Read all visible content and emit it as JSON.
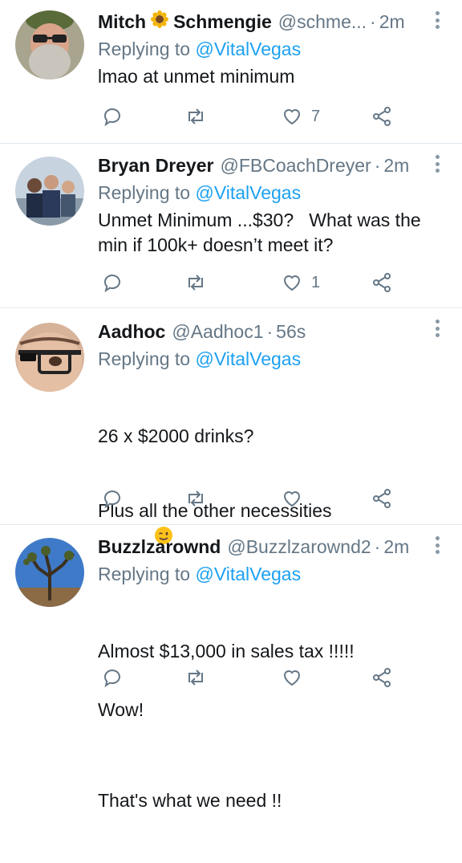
{
  "tweets": [
    {
      "name_part1": "Mitch",
      "name_part2": "Schmengie",
      "handle": "@schme...",
      "time": "2m",
      "reply_prefix": "Replying to",
      "reply_handle": "@VitalVegas",
      "text": "lmao at unmet minimum",
      "like_count": "7"
    },
    {
      "name": "Bryan Dreyer",
      "handle": "@FBCoachDreyer",
      "time": "2m",
      "reply_prefix": "Replying to",
      "reply_handle": "@VitalVegas",
      "text": "Unmet Minimum ...$30?   What was the min if 100k+ doesn’t meet it?",
      "like_count": "1"
    },
    {
      "name": "Aadhoc",
      "handle": "@Aadhoc1",
      "time": "56s",
      "reply_prefix": "Replying to",
      "reply_handle": "@VitalVegas",
      "text_line1": "26 x $2000 drinks?",
      "text_line2": "Plus all the other necessities",
      "text_line3": "Wow!",
      "like_count": ""
    },
    {
      "name": "Buzzlzarownd",
      "handle": "@Buzzlzarownd2",
      "time": "2m",
      "reply_prefix": "Replying to",
      "reply_handle": "@VitalVegas",
      "text_line1": "Almost $13,000 in sales tax !!!!!",
      "text_line2": "That's what we need !!",
      "like_count": ""
    }
  ],
  "icons": {
    "reply": "reply-icon",
    "retweet": "retweet-icon",
    "like": "like-icon",
    "share": "share-icon",
    "more": "more-options-icon",
    "sunflower": "sunflower-emoji",
    "wink": "winking-face-emoji"
  },
  "colors": {
    "link": "#1da1f2",
    "muted": "#657786",
    "text": "#14171a",
    "divider": "#e1e8ed"
  }
}
